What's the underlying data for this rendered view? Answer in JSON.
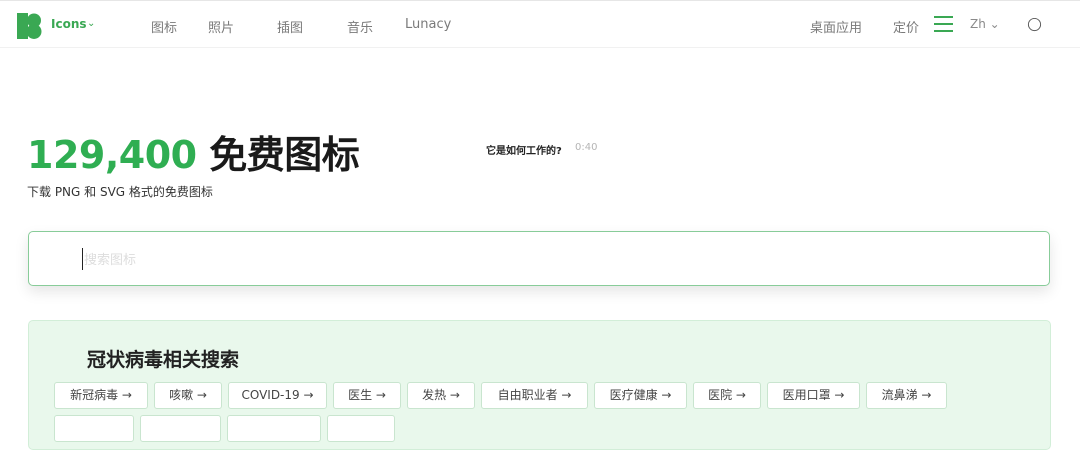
{
  "header": {
    "brand": "Icons",
    "nav": [
      "图标",
      "照片",
      "插图",
      "音乐",
      "Lunacy"
    ],
    "right": [
      "桌面应用",
      "定价"
    ],
    "lang": "Zh"
  },
  "hero": {
    "count": "129,400",
    "title_rest": " 免费图标",
    "subtitle": "下载 PNG 和 SVG 格式的免费图标",
    "how_label": "它是如何工作的?",
    "how_time": "0:40"
  },
  "search": {
    "placeholder": "搜索图标"
  },
  "related": {
    "title": "冠状病毒相关搜索",
    "tags": [
      "新冠病毒 →",
      "咳嗽 →",
      "COVID-19 →",
      "医生 →",
      "发热 →",
      "自由职业者 →",
      "医疗健康 →",
      "医院 →",
      "医用口罩 →",
      "流鼻涕 →"
    ]
  },
  "colors": {
    "accent": "#2fae52",
    "panel_bg": "#e9f8ec"
  },
  "icons": {
    "menu": "hamburger-icon",
    "theme": "moon-icon",
    "chevron": "chevron-down-icon"
  }
}
